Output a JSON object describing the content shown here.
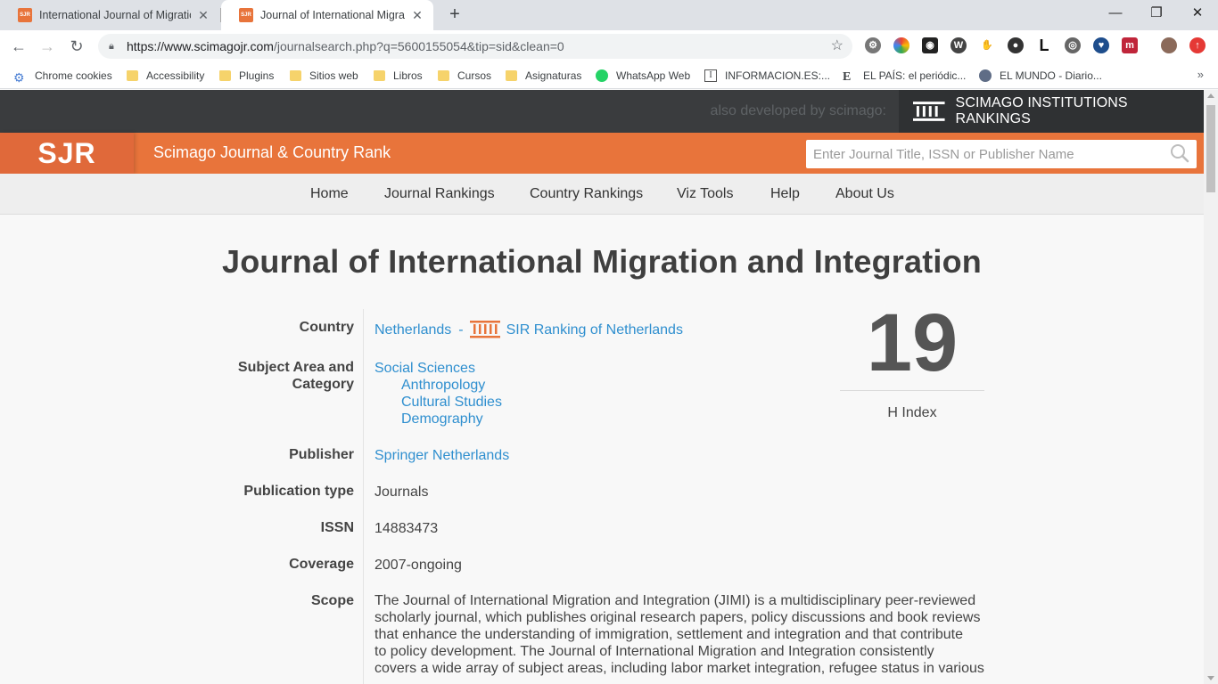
{
  "browser": {
    "tabs": [
      {
        "title": "International Journal of Migration",
        "favicon": "SJR",
        "active": false
      },
      {
        "title": "Journal of International Migration",
        "favicon": "SJR",
        "active": true
      }
    ],
    "url_host": "https://www.scimagojr.com",
    "url_path": "/journalsearch.php?q=5600155054&tip=sid&clean=0",
    "bookmarks": [
      {
        "label": "Chrome cookies",
        "icon": "gear-icon"
      },
      {
        "label": "Accessibility",
        "icon": "folder-icon"
      },
      {
        "label": "Plugins",
        "icon": "folder-icon"
      },
      {
        "label": "Sitios web",
        "icon": "folder-icon"
      },
      {
        "label": "Libros",
        "icon": "folder-icon"
      },
      {
        "label": "Cursos",
        "icon": "folder-icon"
      },
      {
        "label": "Asignaturas",
        "icon": "folder-icon"
      },
      {
        "label": "WhatsApp Web",
        "icon": "whatsapp-icon"
      },
      {
        "label": "INFORMACION.ES:...",
        "icon": "informacion-icon"
      },
      {
        "label": "EL PAÍS: el periódic...",
        "icon": "elpais-icon"
      },
      {
        "label": "EL MUNDO - Diario...",
        "icon": "globe-icon"
      }
    ]
  },
  "site": {
    "also_developed": "also developed by scimago:",
    "sir_label": "SCIMAGO INSTITUTIONS RANKINGS",
    "logo": "SJR",
    "name": "Scimago Journal & Country Rank",
    "search_placeholder": "Enter Journal Title, ISSN or Publisher Name",
    "menu": [
      "Home",
      "Journal Rankings",
      "Country Rankings",
      "Viz Tools",
      "Help",
      "About Us"
    ]
  },
  "journal": {
    "title": "Journal of International Migration and Integration",
    "labels": {
      "country": "Country",
      "subject_line1": "Subject Area and",
      "subject_line2": "Category",
      "publisher": "Publisher",
      "publication_type": "Publication type",
      "issn": "ISSN",
      "coverage": "Coverage",
      "scope": "Scope"
    },
    "country": "Netherlands",
    "country_sep": "-",
    "sir_ranking": "SIR Ranking of Netherlands",
    "subject_area": "Social Sciences",
    "categories": [
      "Anthropology",
      "Cultural Studies",
      "Demography"
    ],
    "publisher": "Springer Netherlands",
    "publication_type": "Journals",
    "issn": "14883473",
    "coverage": "2007-ongoing",
    "scope_lines": [
      "The Journal of International Migration and Integration (JIMI) is a multidisciplinary peer-reviewed",
      "scholarly journal, which publishes original research papers, policy discussions and book reviews",
      "that enhance the understanding of immigration, settlement and integration and that contribute",
      "to policy development. The Journal of International Migration and Integration consistently",
      "covers a wide array of subject areas, including labor market integration, refugee status in various"
    ],
    "h_index": "19",
    "h_index_label": "H Index"
  }
}
